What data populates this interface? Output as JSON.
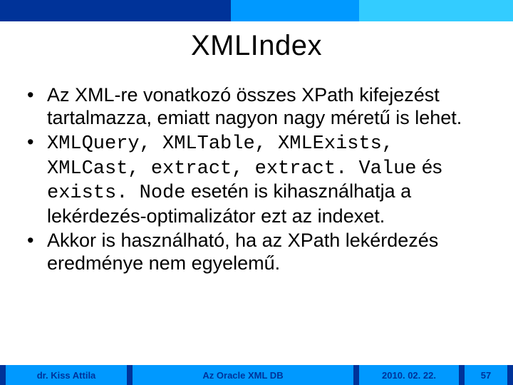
{
  "title": "XMLIndex",
  "bullets": {
    "b1": "Az XML-re vonatkozó összes XPath kifejezést tartalmazza, emiatt nagyon nagy méretű is lehet.",
    "b2_code1": "XMLQuery, XMLTable, XMLExists, XMLCast, extract, extract. Value",
    "b2_mid": " és ",
    "b2_code2": "exists. Node",
    "b2_tail": " esetén is kihasználhatja a lekérdezés-optimalizátor ezt az indexet.",
    "b3": "Akkor is használható, ha az XPath lekérdezés eredménye nem egyelemű."
  },
  "footer": {
    "author": "dr. Kiss Attila",
    "course": "Az Oracle XML DB",
    "date": "2010. 02. 22.",
    "page": "57"
  }
}
